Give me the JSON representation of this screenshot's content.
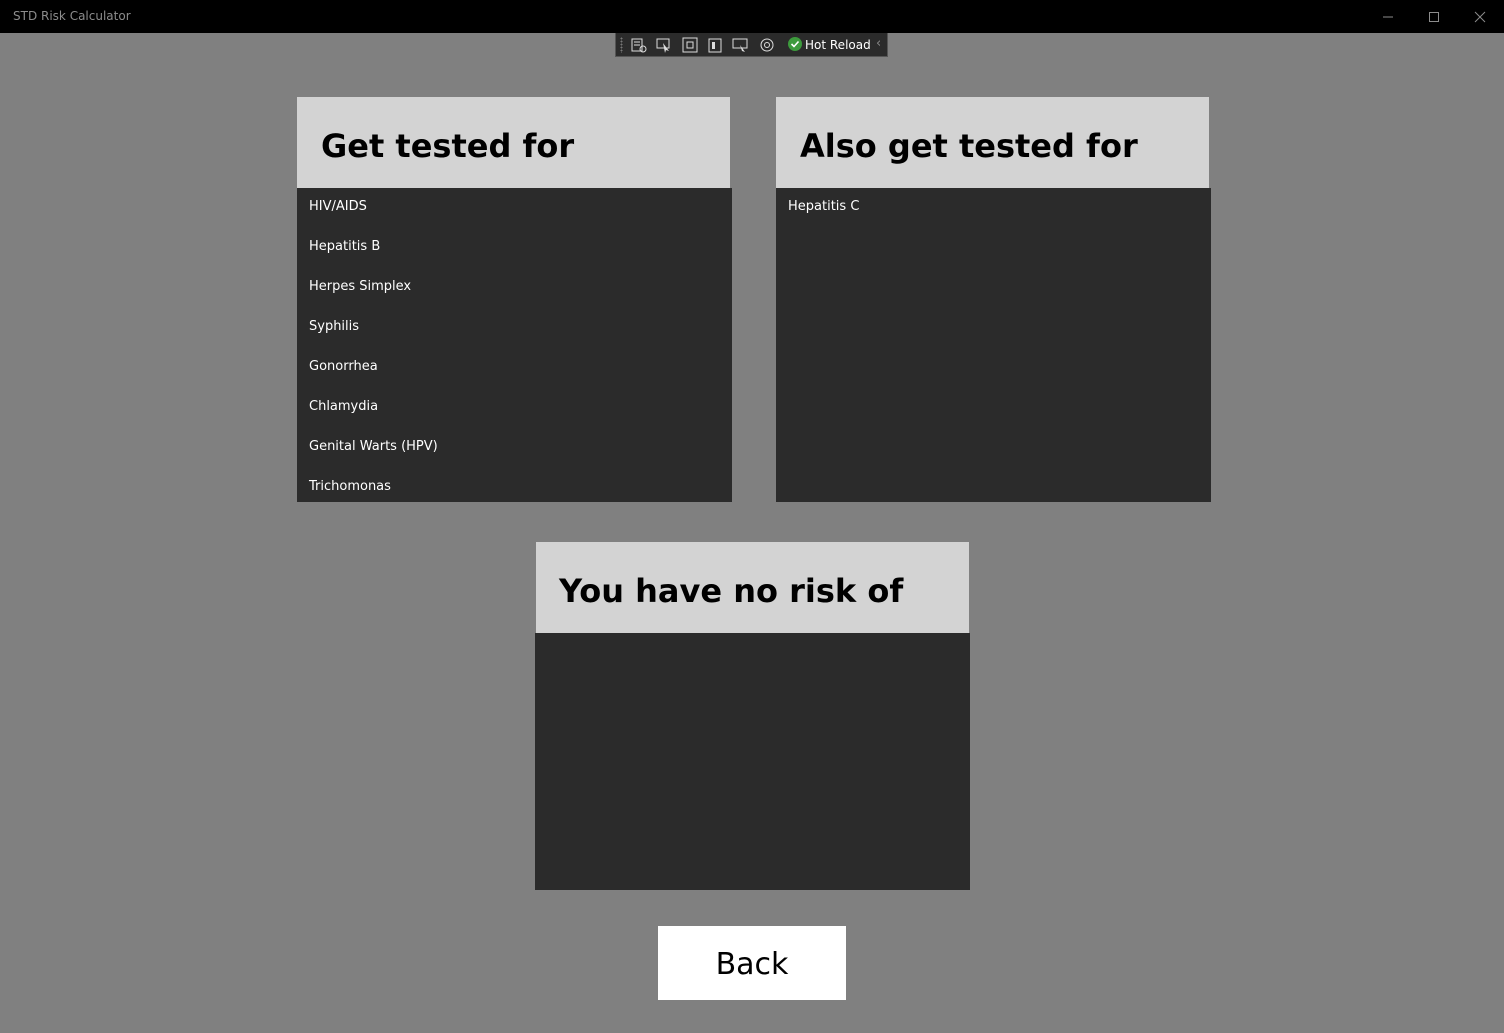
{
  "window": {
    "title": "STD Risk Calculator",
    "minimize_icon": "minimize-icon",
    "maximize_icon": "maximize-icon",
    "close_icon": "close-icon"
  },
  "devtools": {
    "hot_reload_label": "Hot Reload",
    "icons": [
      "live-visual-tree-icon",
      "select-element-icon",
      "display-layout-adorners-icon",
      "track-focus-icon",
      "binding-failures-icon",
      "xaml-hot-reload-icon"
    ]
  },
  "panels": {
    "get_tested": {
      "title": "Get tested for",
      "items": [
        "HIV/AIDS",
        "Hepatitis B",
        "Herpes Simplex",
        "Syphilis",
        "Gonorrhea",
        "Chlamydia",
        "Genital Warts (HPV)",
        "Trichomonas"
      ]
    },
    "also_tested": {
      "title": "Also get tested for",
      "items": [
        "Hepatitis C"
      ]
    },
    "no_risk": {
      "title": "You have no risk of",
      "items": []
    }
  },
  "back_button": {
    "label": "Back"
  },
  "colors": {
    "background": "#808080",
    "panel_header": "#d3d3d3",
    "panel_body": "#2b2b2b",
    "titlebar": "#000000"
  }
}
